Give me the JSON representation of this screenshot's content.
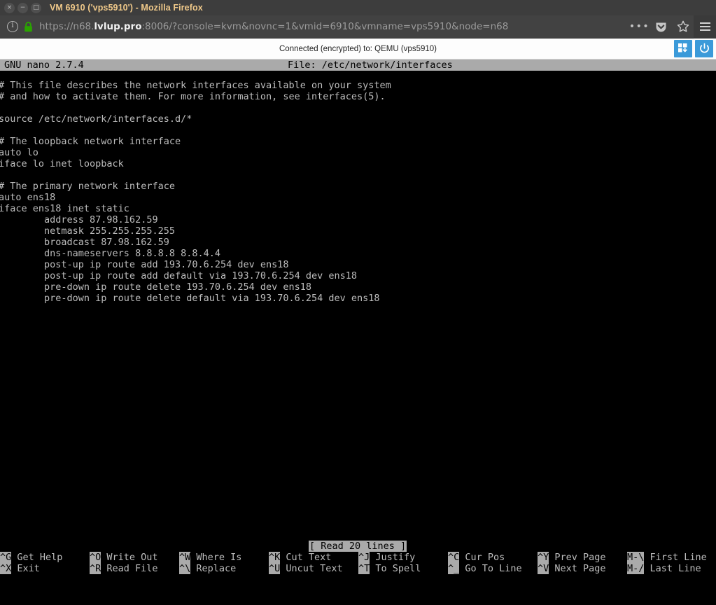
{
  "window": {
    "title": "VM 6910 ('vps5910') - Mozilla Firefox",
    "buttons": {
      "close": "×",
      "minimize": "−",
      "maximize": "□"
    }
  },
  "browser": {
    "url_scheme": "https://n68.",
    "url_host": "lvlup.pro",
    "url_rest": ":8006/?console=kvm&novnc=1&vmid=6910&vmname=vps5910&node=n68",
    "url_full": "https://n68.lvlup.pro:8006/?console=kvm&novnc=1&vmid=6910&vmname=vps5910&node=n68",
    "info_glyph": "i",
    "page_actions_glyph": "•••"
  },
  "novnc": {
    "status": "Connected (encrypted) to: QEMU (vps5910)",
    "accent": "#3b9ad9",
    "buttons": [
      {
        "name": "ctrl-alt-del-button",
        "title": "Send CtrlAltDel"
      },
      {
        "name": "power-button",
        "title": "Power"
      }
    ]
  },
  "nano": {
    "version": "GNU nano 2.7.4",
    "file_label": "File: /etc/network/interfaces",
    "status_message": "[ Read 20 lines ]",
    "lines": [
      "# This file describes the network interfaces available on your system",
      "# and how to activate them. For more information, see interfaces(5).",
      "",
      "source /etc/network/interfaces.d/*",
      "",
      "# The loopback network interface",
      "auto lo",
      "iface lo inet loopback",
      "",
      "# The primary network interface",
      "auto ens18",
      "iface ens18 inet static",
      "        address 87.98.162.59",
      "        netmask 255.255.255.255",
      "        broadcast 87.98.162.59",
      "        dns-nameservers 8.8.8.8 8.8.4.4",
      "        post-up ip route add 193.70.6.254 dev ens18",
      "        post-up ip route add default via 193.70.6.254 dev ens18",
      "        pre-down ip route delete 193.70.6.254 dev ens18",
      "        pre-down ip route delete default via 193.70.6.254 dev ens18"
    ],
    "shortcuts_row1": [
      {
        "key": "^G",
        "label": " Get Help"
      },
      {
        "key": "^O",
        "label": " Write Out"
      },
      {
        "key": "^W",
        "label": " Where Is"
      },
      {
        "key": "^K",
        "label": " Cut Text"
      },
      {
        "key": "^J",
        "label": " Justify"
      },
      {
        "key": "^C",
        "label": " Cur Pos"
      },
      {
        "key": "^Y",
        "label": " Prev Page"
      },
      {
        "key": "M-\\",
        "label": " First Line"
      }
    ],
    "shortcuts_row2": [
      {
        "key": "^X",
        "label": " Exit"
      },
      {
        "key": "^R",
        "label": " Read File"
      },
      {
        "key": "^\\",
        "label": " Replace"
      },
      {
        "key": "^U",
        "label": " Uncut Text"
      },
      {
        "key": "^T",
        "label": " To Spell"
      },
      {
        "key": "^_",
        "label": " Go To Line"
      },
      {
        "key": "^V",
        "label": " Next Page"
      },
      {
        "key": "M-/",
        "label": " Last Line"
      }
    ]
  },
  "colors": {
    "titlebar_bg": "#3d3d3d",
    "titlebar_text": "#f0c98a",
    "toolbar_bg": "#424242",
    "terminal_bg": "#000000",
    "terminal_fg": "#bdbdbd",
    "terminal_invert_bg": "#aaaaaa",
    "lock_green": "#2aa300"
  }
}
